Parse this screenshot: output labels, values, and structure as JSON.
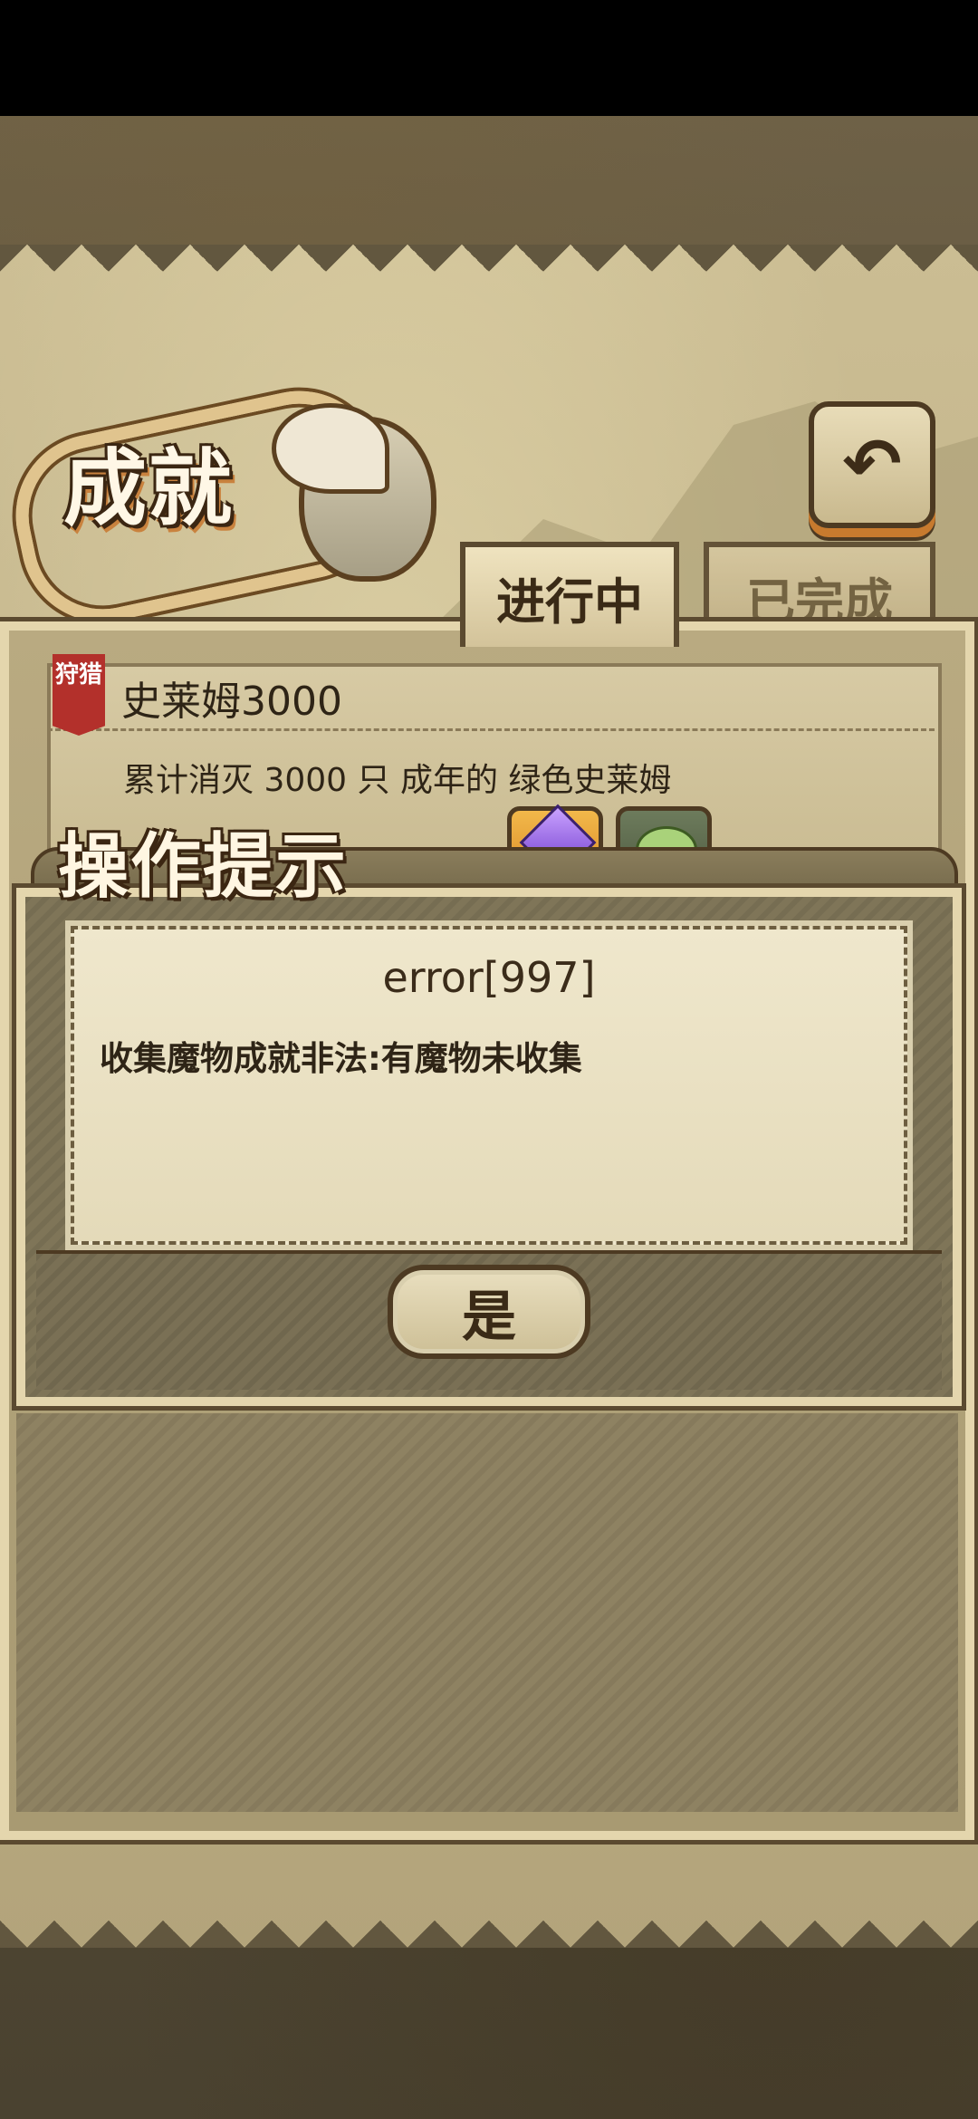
{
  "screen": {
    "title": "成就",
    "back_icon": "↶"
  },
  "tabs": [
    {
      "label": "进行中",
      "active": true
    },
    {
      "label": "已完成",
      "active": false
    }
  ],
  "achievement": {
    "tag": "狩猎",
    "name": "史莱姆3000",
    "description": "累计消灭 3000 只 成年的 绿色史莱姆",
    "rewards": [
      "gem-icon",
      "sprout-icon"
    ]
  },
  "dialog": {
    "title": "操作提示",
    "code": "error[997]",
    "message": "收集魔物成就非法:有魔物未收集",
    "confirm_label": "是"
  },
  "colors": {
    "parchment": "#c7b98f",
    "frame": "#e4d6ad",
    "ink": "#3a2a16",
    "tag_red": "#b3302b"
  }
}
